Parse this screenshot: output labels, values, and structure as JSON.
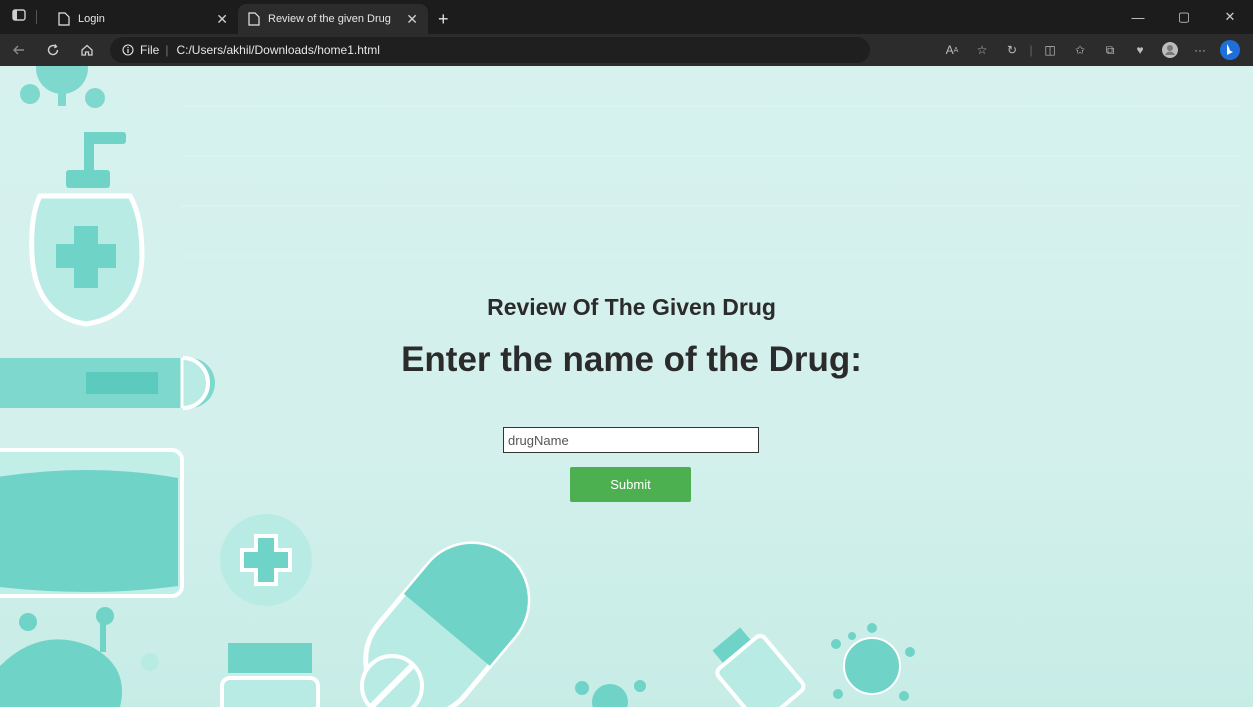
{
  "browser": {
    "tabs": [
      {
        "label": "Login",
        "active": false
      },
      {
        "label": "Review of the given Drug",
        "active": true
      }
    ],
    "new_tab_label": "+",
    "address": {
      "scheme_label": "File",
      "url": "C:/Users/akhil/Downloads/home1.html"
    },
    "more_label": "···"
  },
  "page": {
    "heading_small": "Review Of The Given Drug",
    "heading_large": "Enter the name of the Drug:",
    "input": {
      "placeholder": "drugName",
      "value": ""
    },
    "submit_label": "Submit"
  },
  "colors": {
    "background": "#d7f2ee",
    "accent": "#6fd3c8",
    "button": "#4caf50",
    "text": "#2b2b2b"
  }
}
